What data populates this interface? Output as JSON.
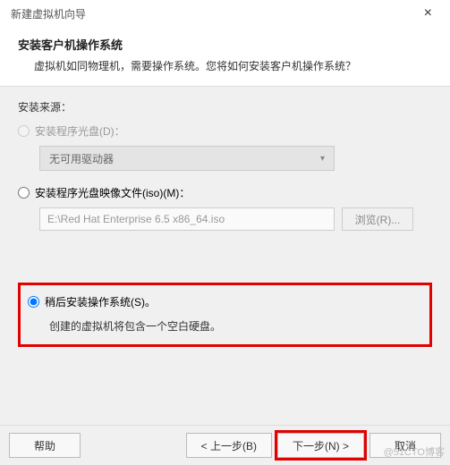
{
  "window": {
    "title": "新建虚拟机向导"
  },
  "header": {
    "title": "安装客户机操作系统",
    "desc": "虚拟机如同物理机，需要操作系统。您将如何安装客户机操作系统？"
  },
  "source_label": "安装来源：",
  "option1": {
    "label": "安装程序光盘(D)：",
    "combo_value": "无可用驱动器"
  },
  "option2": {
    "label": "安装程序光盘映像文件(iso)(M)：",
    "path_value": "E:\\Red Hat Enterprise 6.5 x86_64.iso",
    "browse_label": "浏览(R)..."
  },
  "option3": {
    "label": "稍后安装操作系统(S)。",
    "note": "创建的虚拟机将包含一个空白硬盘。"
  },
  "footer": {
    "help": "帮助",
    "back": "< 上一步(B)",
    "next": "下一步(N) >",
    "cancel": "取消"
  },
  "watermark": "@51CTO博客"
}
